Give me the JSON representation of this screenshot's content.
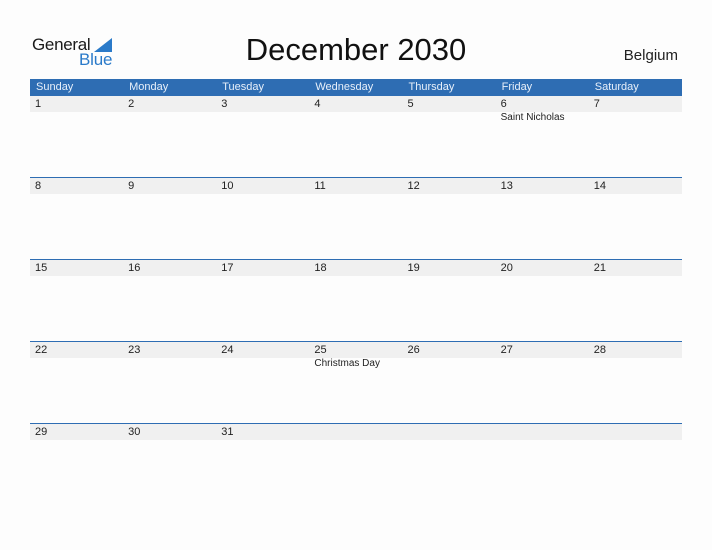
{
  "logo": {
    "general": "General",
    "blue": "Blue"
  },
  "title": "December 2030",
  "country": "Belgium",
  "colors": {
    "header_bg": "#2e6db3",
    "strip_bg": "#f0f0f0",
    "logo_blue": "#2a7ac9"
  },
  "days": [
    "Sunday",
    "Monday",
    "Tuesday",
    "Wednesday",
    "Thursday",
    "Friday",
    "Saturday"
  ],
  "weeks": [
    [
      {
        "d": "1"
      },
      {
        "d": "2"
      },
      {
        "d": "3"
      },
      {
        "d": "4"
      },
      {
        "d": "5"
      },
      {
        "d": "6",
        "h": "Saint Nicholas"
      },
      {
        "d": "7"
      }
    ],
    [
      {
        "d": "8"
      },
      {
        "d": "9"
      },
      {
        "d": "10"
      },
      {
        "d": "11"
      },
      {
        "d": "12"
      },
      {
        "d": "13"
      },
      {
        "d": "14"
      }
    ],
    [
      {
        "d": "15"
      },
      {
        "d": "16"
      },
      {
        "d": "17"
      },
      {
        "d": "18"
      },
      {
        "d": "19"
      },
      {
        "d": "20"
      },
      {
        "d": "21"
      }
    ],
    [
      {
        "d": "22"
      },
      {
        "d": "23"
      },
      {
        "d": "24"
      },
      {
        "d": "25",
        "h": "Christmas Day"
      },
      {
        "d": "26"
      },
      {
        "d": "27"
      },
      {
        "d": "28"
      }
    ],
    [
      {
        "d": "29"
      },
      {
        "d": "30"
      },
      {
        "d": "31"
      },
      {
        "d": ""
      },
      {
        "d": ""
      },
      {
        "d": ""
      },
      {
        "d": ""
      }
    ]
  ]
}
